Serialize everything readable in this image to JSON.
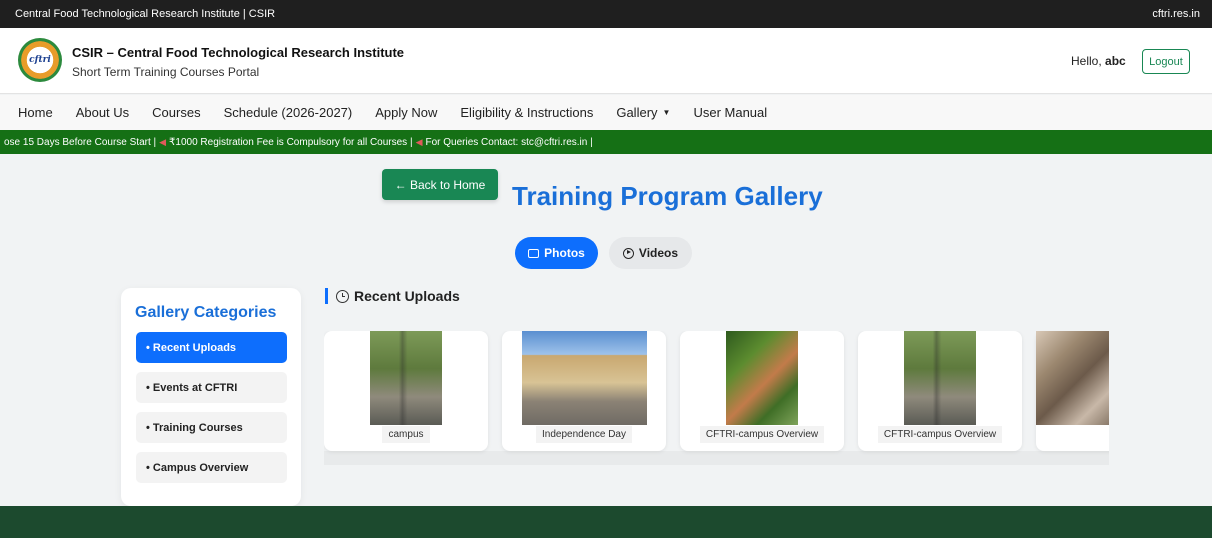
{
  "topbar": {
    "left_text": "Central Food Technological Research Institute | CSIR",
    "right_link": "cftri.res.in"
  },
  "header": {
    "logo_text": "cftri",
    "title": "CSIR – Central Food Technological Research Institute",
    "subtitle": "Short Term Training Courses Portal",
    "greeting": "Hello,",
    "username": "abc",
    "logout_label": "Logout"
  },
  "nav": {
    "items": [
      {
        "label": "Home"
      },
      {
        "label": "About Us"
      },
      {
        "label": "Courses"
      },
      {
        "label": "Schedule (2026-2027)"
      },
      {
        "label": "Apply Now"
      },
      {
        "label": "Eligibility & Instructions"
      },
      {
        "label": "Gallery",
        "has_dropdown": true
      },
      {
        "label": "User Manual"
      }
    ]
  },
  "ticker": {
    "part1": "ose 15 Days Before Course Start |",
    "part2": "₹1000 Registration Fee is Compulsory for all Courses |",
    "part3": "For Queries Contact: stc@cftri.res.in |",
    "icon": "megaphone-icon"
  },
  "main": {
    "back_label": "← Back to Home",
    "title": "Training Program Gallery",
    "tabs": [
      {
        "label": "Photos",
        "active": true
      },
      {
        "label": "Videos",
        "active": false
      }
    ],
    "accent": "#0d6efd",
    "brand_green": "#198754"
  },
  "sidebar": {
    "title": "Gallery Categories",
    "items": [
      {
        "label": "• Recent Uploads",
        "active": true
      },
      {
        "label": "• Events at CFTRI",
        "active": false
      },
      {
        "label": "• Training Courses",
        "active": false
      },
      {
        "label": "• Campus Overview",
        "active": false
      }
    ]
  },
  "gallery": {
    "heading": "Recent Uploads",
    "cards": [
      {
        "caption": "campus"
      },
      {
        "caption": "Independence Day"
      },
      {
        "caption": "CFTRI-campus Overview"
      },
      {
        "caption": "CFTRI-campus Overview"
      },
      {
        "caption": ""
      }
    ]
  }
}
